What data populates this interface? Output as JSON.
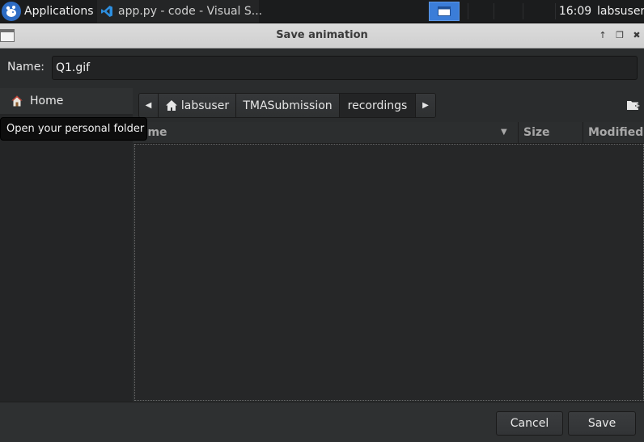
{
  "panel": {
    "apps_label": "Applications",
    "task_label": "app.py - code - Visual S...",
    "clock": "16:09",
    "user": "labsuser",
    "icons": {
      "apps": "xfce-mouse-logo-icon",
      "task": "vscode-icon",
      "workspace": "window-icon"
    }
  },
  "dialog": {
    "title": "Save animation",
    "title_buttons": [
      "↑",
      "❒",
      "✖"
    ]
  },
  "name_row": {
    "label": "Name:",
    "value": "Q1.gif"
  },
  "sidebar": {
    "items": [
      {
        "label": "Home",
        "icon": "home-icon"
      }
    ],
    "tooltip": "Open your personal folder"
  },
  "pathbar": {
    "segments": [
      "labsuser",
      "TMASubmission",
      "recordings"
    ],
    "active": "recordings"
  },
  "file_list": {
    "columns": [
      "Name",
      "Size",
      "Modified"
    ],
    "visible_name_header": "ame",
    "rows": []
  },
  "buttons": {
    "cancel": "Cancel",
    "save": "Save"
  },
  "colors": {
    "accent": "#3b7dd8",
    "panel": "#1b1c1d",
    "dialog_bg": "#2a2c2d"
  }
}
